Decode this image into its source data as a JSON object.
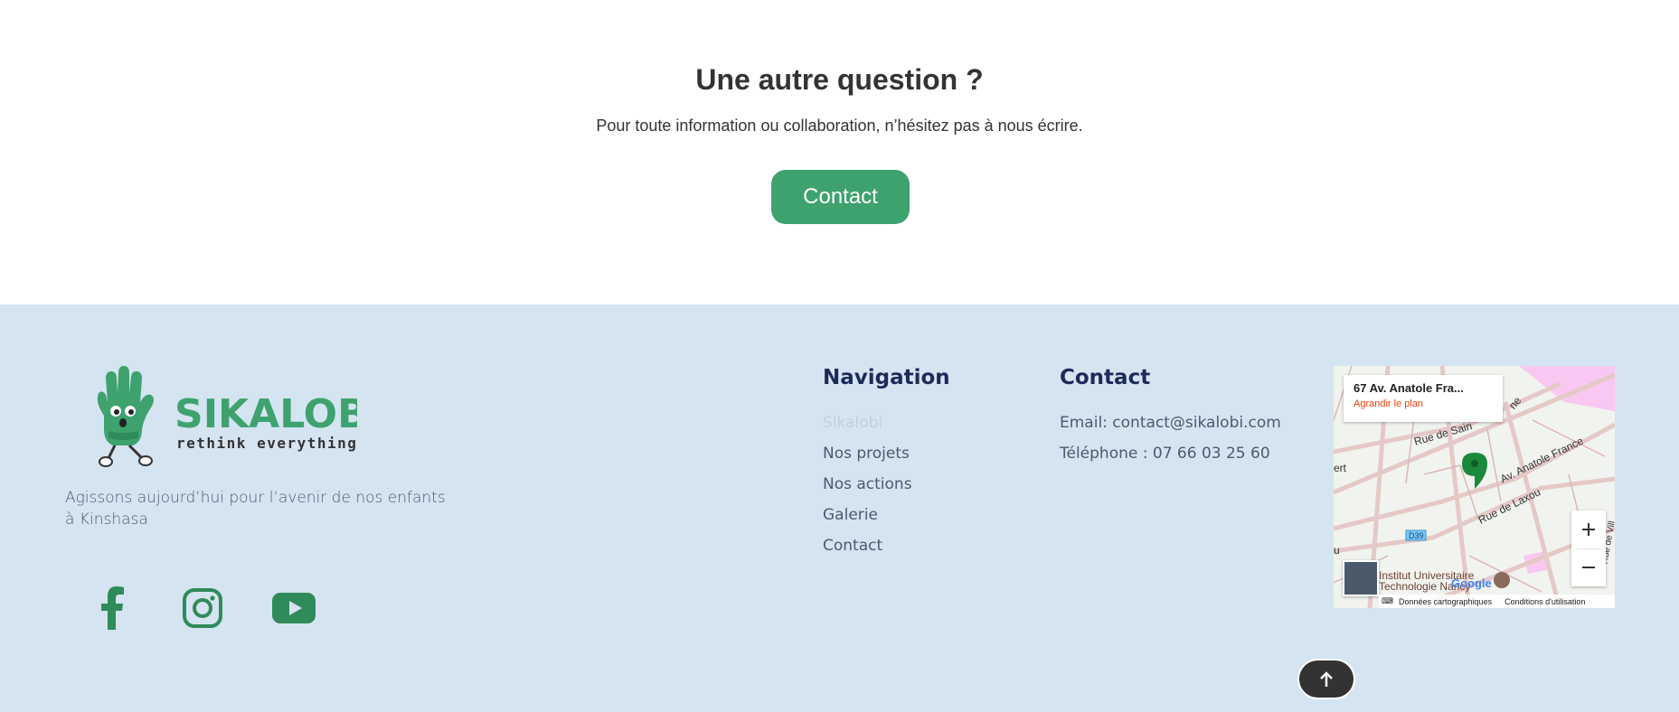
{
  "cta": {
    "title": "Une autre question ?",
    "subtitle": "Pour toute information ou collaboration, n’hésitez pas à nous écrire.",
    "button_label": "Contact",
    "button_color": "#3ea26e"
  },
  "footer": {
    "background": "#d5e4f1",
    "logo": {
      "brand": "SIKALOBi",
      "slogan": "rethink everything"
    },
    "tagline": "Agissons aujourd’hui pour l’avenir de nos enfants à Kinshasa",
    "social": [
      {
        "icon": "facebook-icon"
      },
      {
        "icon": "instagram-icon"
      },
      {
        "icon": "youtube-icon"
      }
    ],
    "navigation": {
      "title": "Navigation",
      "items": [
        {
          "label": "Sikalobi",
          "active": true
        },
        {
          "label": "Nos projets"
        },
        {
          "label": "Nos actions"
        },
        {
          "label": "Galerie"
        },
        {
          "label": "Contact"
        }
      ]
    },
    "contact": {
      "title": "Contact",
      "email": "Email: contact@sikalobi.com",
      "phone": "Téléphone : 07 66 03 25 60"
    },
    "map": {
      "place_title": "67 Av. Anatole Fra...",
      "enlarge_link": "Agrandir le plan",
      "streets": [
        "Rue de Sain",
        "ne",
        "Av. Anatole France",
        "Rue de Laxou",
        "ert",
        "u",
        "Rue de Vill"
      ],
      "road_badge": "D39",
      "poi": "Institut Universitaire Technologie Nancy",
      "google": "Google",
      "map_data": "Données cartographiques",
      "terms": "Conditions d'utilisation",
      "marker_color": "#1a8a3a"
    }
  }
}
